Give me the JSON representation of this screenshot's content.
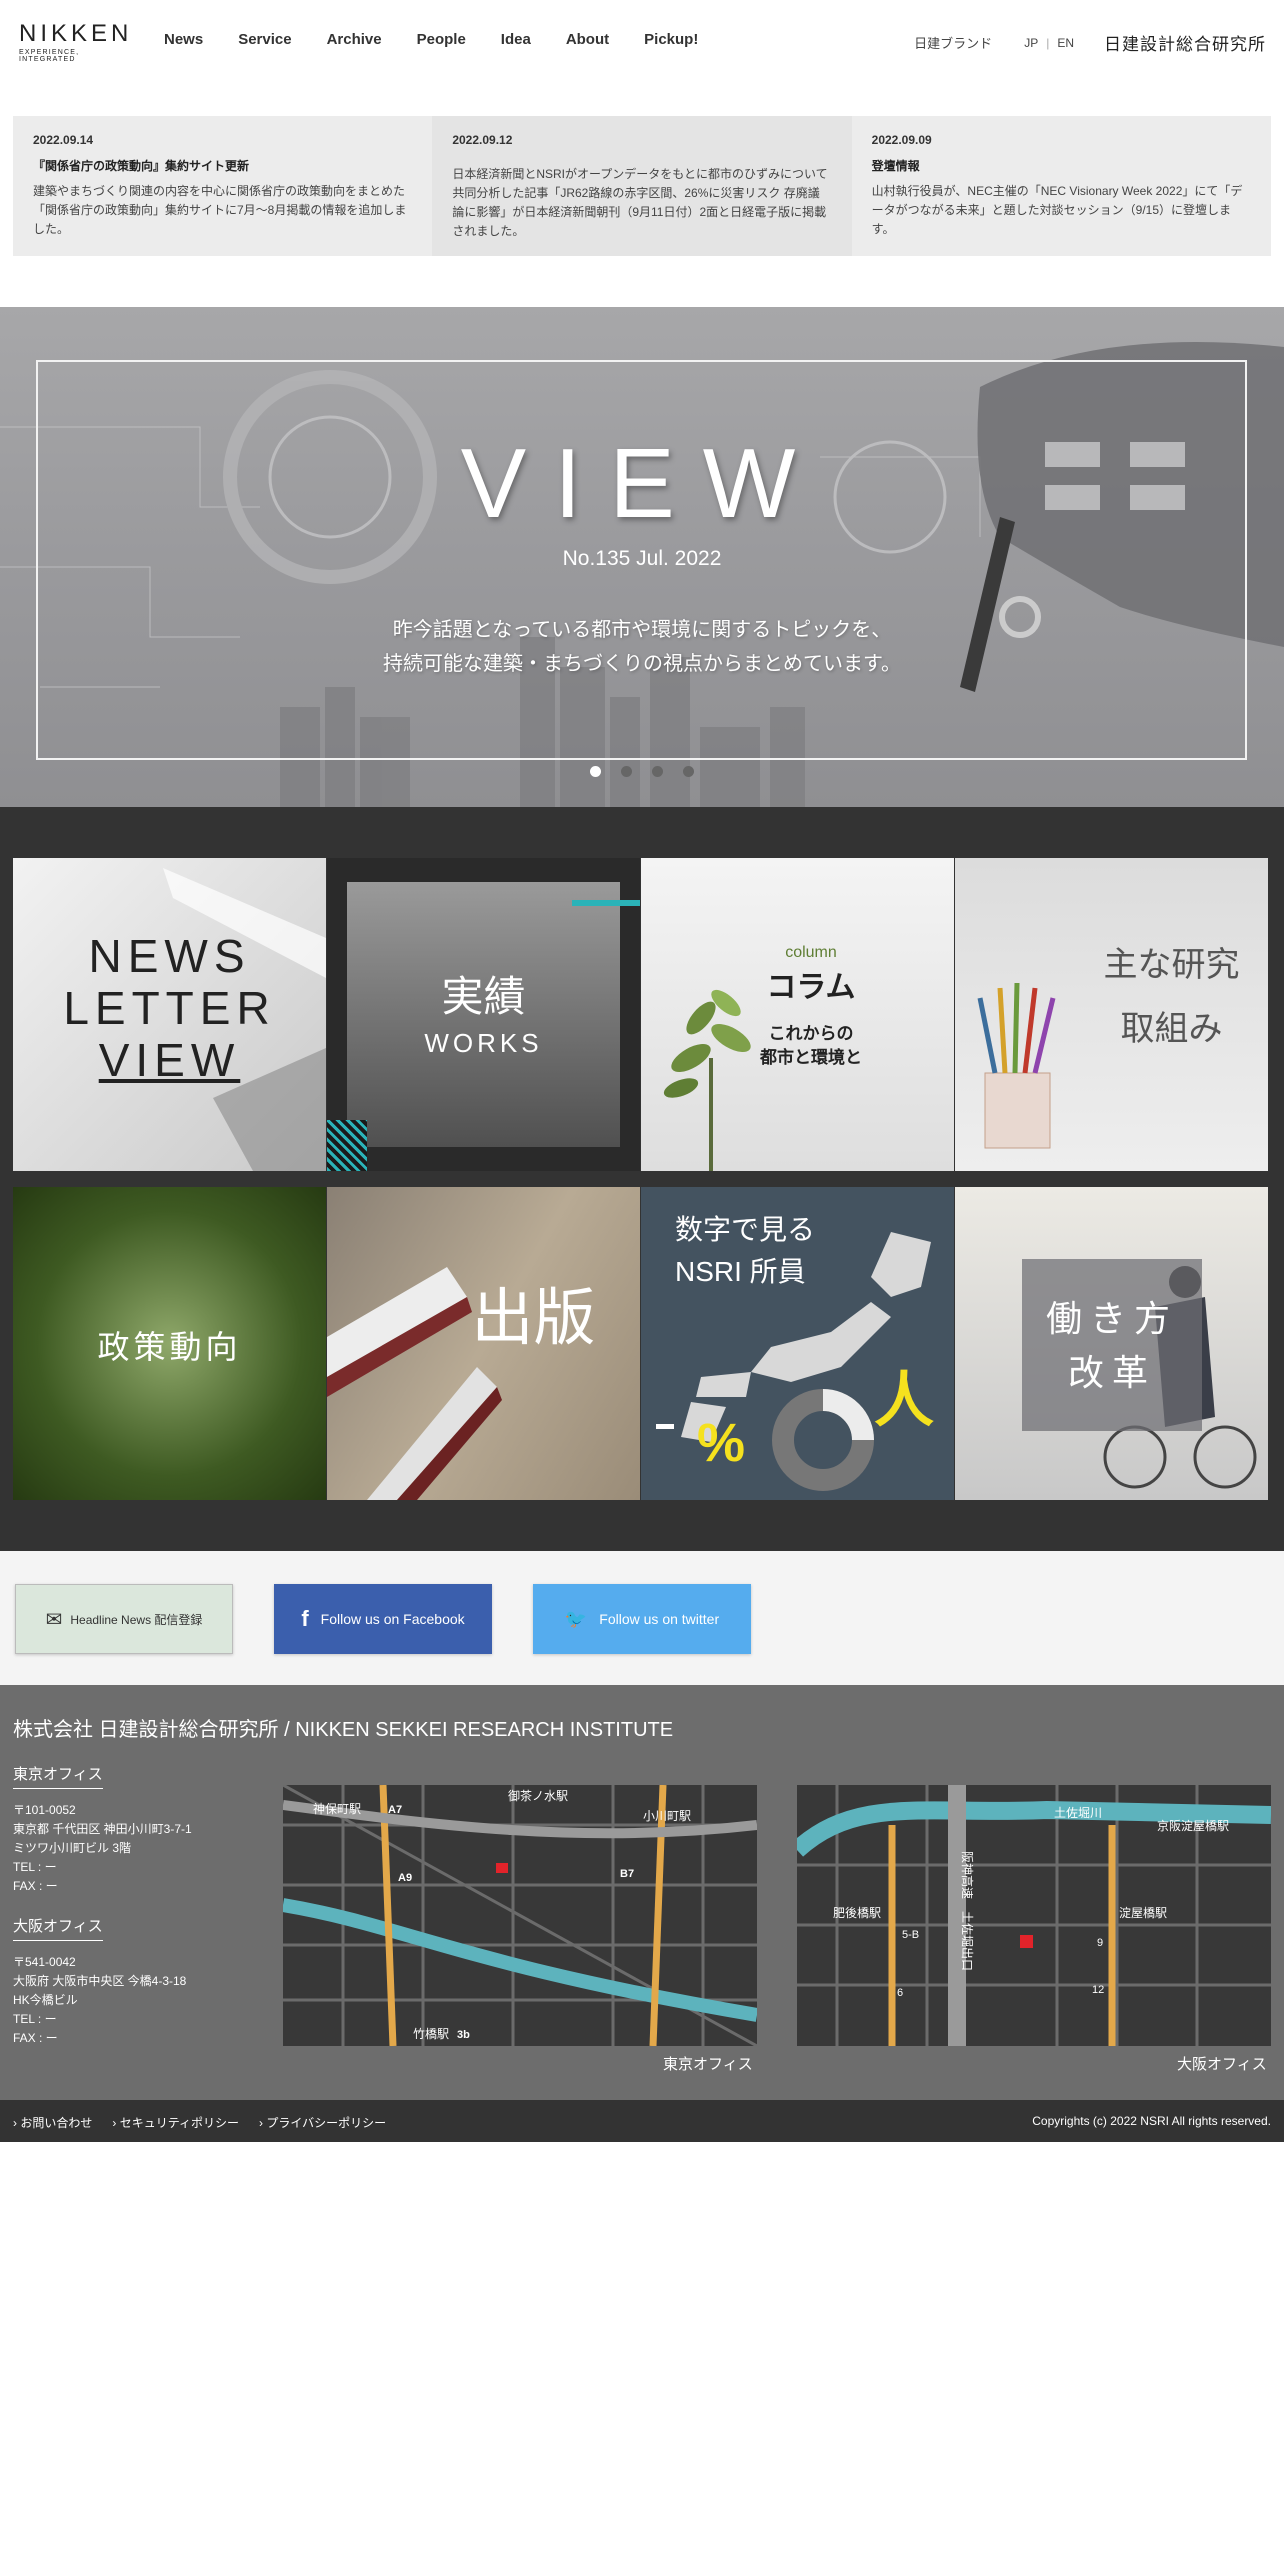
{
  "header": {
    "logo_main": "NIKKEN",
    "logo_sub": "EXPERIENCE, INTEGRATED",
    "nav": [
      "News",
      "Service",
      "Archive",
      "People",
      "Idea",
      "About",
      "Pickup!"
    ],
    "brand_link": "日建ブランド",
    "lang_jp": "JP",
    "lang_sep": "|",
    "lang_en": "EN",
    "corp_name": "日建設計総合研究所"
  },
  "news": [
    {
      "date": "2022.09.14",
      "title": "『関係省庁の政策動向』集約サイト更新",
      "body": "建築やまちづくり関連の内容を中心に関係省庁の政策動向をまとめた「関係省庁の政策動向」集約サイトに7月～8月掲載の情報を追加しました。"
    },
    {
      "date": "2022.09.12",
      "title": "",
      "body": "日本経済新聞とNSRIがオープンデータをもとに都市のひずみについて共同分析した記事「JR62路線の赤字区間、26%に災害リスク 存廃議論に影響」が日本経済新聞朝刊（9月11日付）2面と日経電子版に掲載されました。"
    },
    {
      "date": "2022.09.09",
      "title": "登壇情報",
      "body": "山村執行役員が、NEC主催の「NEC Visionary Week 2022」にて「データがつながる未来」と題した対談セッション（9/15）に登壇します。"
    }
  ],
  "hero": {
    "title": "VIEW",
    "issue": "No.135 Jul. 2022",
    "lead_line1": "昨今話題となっている都市や環境に関するトピックを、",
    "lead_line2": "持続可能な建築・まちづくりの視点からまとめています。",
    "slide_count": 4,
    "active_slide": 1
  },
  "tiles": {
    "newsletter": [
      "NEWS",
      "LETTER",
      "VIEW"
    ],
    "works_jp": "実績",
    "works_en": "WORKS",
    "column_en": "column",
    "column_jp": "コラム",
    "column_sub1": "これからの",
    "column_sub2": "都市と環境と",
    "research_line1": "主な研究",
    "research_line2": "取組み",
    "policy": "政策動向",
    "publication": "出版",
    "numbers_line1": "数字で見る",
    "numbers_line2": "NSRI 所員",
    "numbers_percent": "%",
    "numbers_person": "人",
    "workstyle_line1": "働き方",
    "workstyle_line2": "改革"
  },
  "social": {
    "newsletter_btn": "Headline News 配信登録",
    "facebook_btn": "Follow us on Facebook",
    "twitter_btn": "Follow us on twitter"
  },
  "footer": {
    "company": "株式会社 日建設計総合研究所 / NIKKEN SEKKEI RESEARCH INSTITUTE",
    "tokyo": {
      "heading": "東京オフィス",
      "lines": [
        "〒101-0052",
        "東京都 千代田区 神田小川町3-7-1",
        "ミツワ小川町ビル 3階",
        "TEL : ー",
        "FAX : ー"
      ]
    },
    "osaka": {
      "heading": "大阪オフィス",
      "lines": [
        "〒541-0042",
        "大阪府 大阪市中央区 今橋4-3-18",
        "HK今橋ビル",
        "TEL : ー",
        "FAX : ー"
      ]
    },
    "tokyo_map": {
      "caption": "東京オフィス",
      "labels": [
        "神保町駅",
        "A7",
        "御茶ノ水駅",
        "小川町駅",
        "A9",
        "B7",
        "竹橋駅",
        "3b"
      ]
    },
    "osaka_map": {
      "caption": "大阪オフィス",
      "labels": [
        "土佐堀川",
        "京阪淀屋橋駅",
        "肥後橋駅",
        "阪神高速",
        "土佐堀出口",
        "淀屋橋駅",
        "5-B",
        "6",
        "9",
        "12"
      ]
    },
    "links": [
      "お問い合わせ",
      "セキュリティポリシー",
      "プライバシーポリシー"
    ],
    "copyright": "Copyrights (c) 2022 NSRI All rights reserved."
  }
}
